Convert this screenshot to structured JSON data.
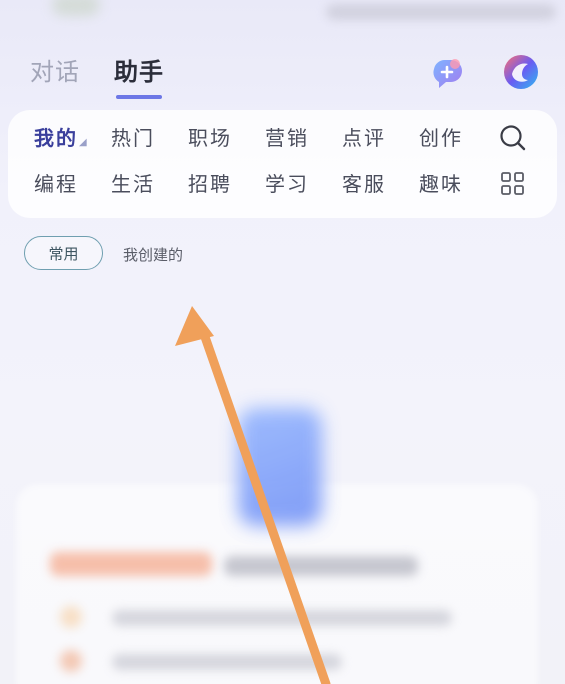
{
  "top_tabs": [
    {
      "label": "对话",
      "active": false
    },
    {
      "label": "助手",
      "active": true
    }
  ],
  "header_icons": {
    "add_chat": "add-chat-icon",
    "app_logo": "app-logo-icon"
  },
  "categories": [
    {
      "label": "我的",
      "active": true
    },
    {
      "label": "热门",
      "active": false
    },
    {
      "label": "职场",
      "active": false
    },
    {
      "label": "营销",
      "active": false
    },
    {
      "label": "点评",
      "active": false
    },
    {
      "label": "创作",
      "active": false
    },
    {
      "label": "编程",
      "active": false
    },
    {
      "label": "生活",
      "active": false
    },
    {
      "label": "招聘",
      "active": false
    },
    {
      "label": "学习",
      "active": false
    },
    {
      "label": "客服",
      "active": false
    },
    {
      "label": "趣味",
      "active": false
    }
  ],
  "category_icons": {
    "search": "search-icon",
    "more": "grid-icon"
  },
  "filters": {
    "common": "常用",
    "mine_created": "我创建的"
  },
  "colors": {
    "accent": "#6d77e6",
    "annotation_arrow": "#f0a05a",
    "chip_border": "#6f9fb0"
  }
}
